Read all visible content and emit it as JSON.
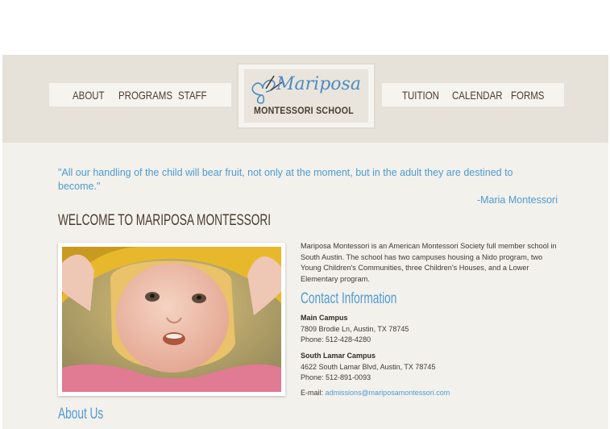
{
  "nav": {
    "left": [
      "ABOUT",
      "PROGRAMS",
      "STAFF"
    ],
    "right": [
      "TUITION",
      "CALENDAR",
      "FORMS"
    ]
  },
  "logo": {
    "script": "Mariposa",
    "sub": "MONTESSORI SCHOOL",
    "icon": "butterfly-icon"
  },
  "quote": {
    "text": "\"All our handling of the child will bear fruit, not only at the moment, but in the adult they are destined to become.\"",
    "author": "-Maria Montessori"
  },
  "welcome_title": "WELCOME TO MARIPOSA MONTESSORI",
  "intro": "Mariposa Montessori is an American Montessori Society full member school in South Austin. The school has two campuses housing a Nido program, two Young Children's Communities, three Children's Houses, and a Lower Elementary program.",
  "contact": {
    "title": "Contact Information",
    "main": {
      "name": "Main Campus",
      "address": "7809 Brodie Ln, Austin, TX 78745",
      "phone": "Phone: 512-428-4280"
    },
    "lamar": {
      "name": "South Lamar Campus",
      "address": "4622 South Lamar Blvd, Austin, TX 78745",
      "phone": "Phone: 512-891-0093"
    },
    "email_label": "E-mail:",
    "email": "admissions@mariposamontessori.com"
  },
  "about_title": "About Us",
  "colors": {
    "accent": "#4d9bd2",
    "brown": "#4a3b30",
    "header": "#e6e2d9",
    "page": "#f3f1ec"
  }
}
